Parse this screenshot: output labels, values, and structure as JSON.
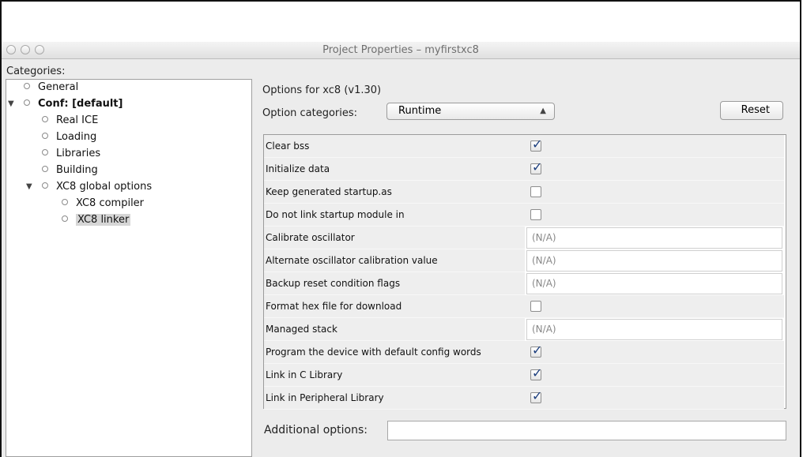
{
  "window": {
    "title": "Project Properties – myfirstxc8"
  },
  "categories": {
    "label": "Categories:",
    "tree": [
      {
        "label": "General",
        "level": 1,
        "bold": false,
        "expanded": null,
        "selected": false
      },
      {
        "label": "Conf: [default]",
        "level": 1,
        "bold": true,
        "expanded": true,
        "selected": false
      },
      {
        "label": "Real ICE",
        "level": 2,
        "bold": false,
        "expanded": null,
        "selected": false
      },
      {
        "label": "Loading",
        "level": 2,
        "bold": false,
        "expanded": null,
        "selected": false
      },
      {
        "label": "Libraries",
        "level": 2,
        "bold": false,
        "expanded": null,
        "selected": false
      },
      {
        "label": "Building",
        "level": 2,
        "bold": false,
        "expanded": null,
        "selected": false
      },
      {
        "label": "XC8 global options",
        "level": 2,
        "bold": false,
        "expanded": true,
        "selected": false
      },
      {
        "label": "XC8 compiler",
        "level": 3,
        "bold": false,
        "expanded": null,
        "selected": false
      },
      {
        "label": "XC8 linker",
        "level": 3,
        "bold": false,
        "expanded": null,
        "selected": true
      }
    ]
  },
  "options": {
    "header": "Options for xc8 (v1.30)",
    "category_label": "Option categories:",
    "category_value": "Runtime",
    "reset_label": "Reset",
    "rows": [
      {
        "label": "Clear bss",
        "type": "checkbox",
        "checked": true
      },
      {
        "label": "Initialize data",
        "type": "checkbox",
        "checked": true
      },
      {
        "label": "Keep generated startup.as",
        "type": "checkbox",
        "checked": false
      },
      {
        "label": "Do not link startup module in",
        "type": "checkbox",
        "checked": false
      },
      {
        "label": "Calibrate oscillator",
        "type": "text",
        "value": "(N/A)"
      },
      {
        "label": "Alternate oscillator calibration value",
        "type": "text",
        "value": "(N/A)"
      },
      {
        "label": "Backup reset condition flags",
        "type": "text",
        "value": "(N/A)"
      },
      {
        "label": "Format hex file for download",
        "type": "checkbox",
        "checked": false
      },
      {
        "label": "Managed stack",
        "type": "text",
        "value": "(N/A)"
      },
      {
        "label": "Program the device with default config words",
        "type": "checkbox",
        "checked": true
      },
      {
        "label": "Link in C Library",
        "type": "checkbox",
        "checked": true
      },
      {
        "label": "Link in Peripheral Library",
        "type": "checkbox",
        "checked": true
      }
    ],
    "additional_label": "Additional options:",
    "additional_value": ""
  },
  "colors": {
    "checkmark": "#1c3e7e",
    "selection": "#d6d6d6",
    "panel": "#ececec"
  }
}
